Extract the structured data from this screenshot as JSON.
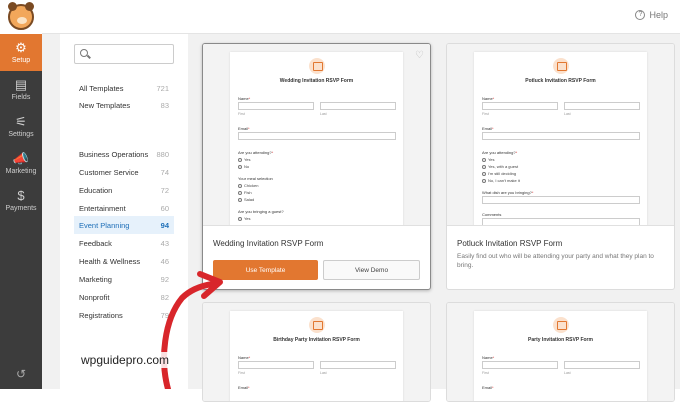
{
  "topbar": {
    "help_label": "Help",
    "help_icon": "?"
  },
  "sidebar": {
    "items": [
      {
        "label": "Setup",
        "icon": "⚙"
      },
      {
        "label": "Fields",
        "icon": "▤"
      },
      {
        "label": "Settings",
        "icon": "⚟"
      },
      {
        "label": "Marketing",
        "icon": "📣"
      },
      {
        "label": "Payments",
        "icon": "$"
      }
    ],
    "bottom_icon": "↺"
  },
  "categories": {
    "search_placeholder": "",
    "groups": [
      {
        "label": "All Templates",
        "count": "721"
      },
      {
        "label": "New Templates",
        "count": "83"
      }
    ],
    "items": [
      {
        "label": "Business Operations",
        "count": "880"
      },
      {
        "label": "Customer Service",
        "count": "74"
      },
      {
        "label": "Education",
        "count": "72"
      },
      {
        "label": "Entertainment",
        "count": "60"
      },
      {
        "label": "Event Planning",
        "count": "94"
      },
      {
        "label": "Feedback",
        "count": "43"
      },
      {
        "label": "Health & Wellness",
        "count": "46"
      },
      {
        "label": "Marketing",
        "count": "92"
      },
      {
        "label": "Nonprofit",
        "count": "82"
      },
      {
        "label": "Registrations",
        "count": "79"
      }
    ]
  },
  "templates": [
    {
      "name": "Wedding Invitation RSVP Form",
      "description": "",
      "use_label": "Use Template",
      "demo_label": "View Demo",
      "preview": {
        "title": "Wedding Invitation RSVP Form",
        "name_label": "Name",
        "first": "First",
        "last": "Last",
        "email_label": "Email",
        "q1": "Are you attending?",
        "q1_opts": [
          "Yes",
          "No"
        ],
        "q2": "Your meal selection",
        "q2_opts": [
          "Chicken",
          "Fish",
          "Salad"
        ],
        "q3": "Are you bringing a guest?",
        "q3_opts": [
          "Yes"
        ]
      }
    },
    {
      "name": "Potluck Invitation RSVP Form",
      "description": "Easily find out who will be attending your party and what they plan to bring.",
      "preview": {
        "title": "Potluck Invitation RSVP Form",
        "name_label": "Name",
        "first": "First",
        "last": "Last",
        "email_label": "Email",
        "q1": "Are you attending?",
        "q1_opts": [
          "Yes",
          "Yes, with a guest",
          "I'm still deciding",
          "No, I can't make it"
        ],
        "q2": "What dish are you bringing?",
        "q3": "Comments"
      }
    },
    {
      "preview": {
        "title": "Birthday Party Invitation RSVP Form",
        "name_label": "Name",
        "first": "First",
        "last": "Last",
        "email_label": "Email"
      }
    },
    {
      "preview": {
        "title": "Party Invitation RSVP Form",
        "name_label": "Name",
        "first": "First",
        "last": "Last",
        "email_label": "Email"
      }
    }
  ],
  "watermark": "wpguidepro.com",
  "colors": {
    "accent": "#e27730",
    "sidebar": "#3c3c3c",
    "active_category": "#1e6fb8"
  }
}
